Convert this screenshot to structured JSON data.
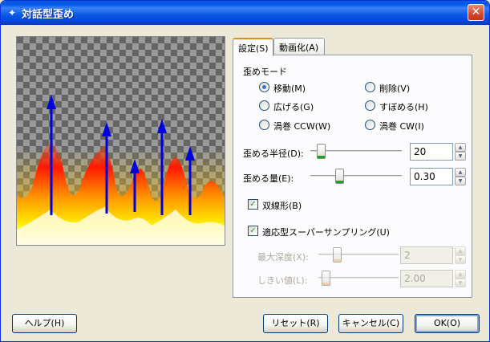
{
  "window": {
    "title": "対話型歪め",
    "close_symbol": "✕",
    "app_icon": "gimp-icon"
  },
  "tabs": [
    {
      "label": "設定(S)",
      "active": true
    },
    {
      "label": "動画化(A)",
      "active": false
    }
  ],
  "settings": {
    "mode_label": "歪めモード",
    "modes": [
      {
        "label": "移動(M)",
        "selected": true
      },
      {
        "label": "削除(V)",
        "selected": false
      },
      {
        "label": "広げる(G)",
        "selected": false
      },
      {
        "label": "すぼめる(H)",
        "selected": false
      },
      {
        "label": "渦巻 CCW(W)",
        "selected": false
      },
      {
        "label": "渦巻 CW(I)",
        "selected": false
      }
    ],
    "radius": {
      "label": "歪める半径(D):",
      "value": "20",
      "fraction": 0.08
    },
    "amount": {
      "label": "歪める量(E):",
      "value": "0.30",
      "fraction": 0.3
    },
    "bilinear": {
      "label": "双線形(B)",
      "checked": true
    },
    "supersampling": {
      "label": "適応型スーパーサンプリング(U)",
      "checked": true
    },
    "max_depth": {
      "label": "最大深度(X):",
      "value": "2",
      "fraction": 0.2
    },
    "threshold": {
      "label": "しきい値(L):",
      "value": "2.00",
      "fraction": 0.05
    }
  },
  "buttons": {
    "help": "ヘルプ(H)",
    "reset": "リセット(R)",
    "cancel": "キャンセル(C)",
    "ok": "OK(O)"
  },
  "colors": {
    "titlebar": "#0a58e4",
    "arrow": "#0000dd",
    "flame_yellow": "#ffee00",
    "flame_red": "#ff2000"
  }
}
